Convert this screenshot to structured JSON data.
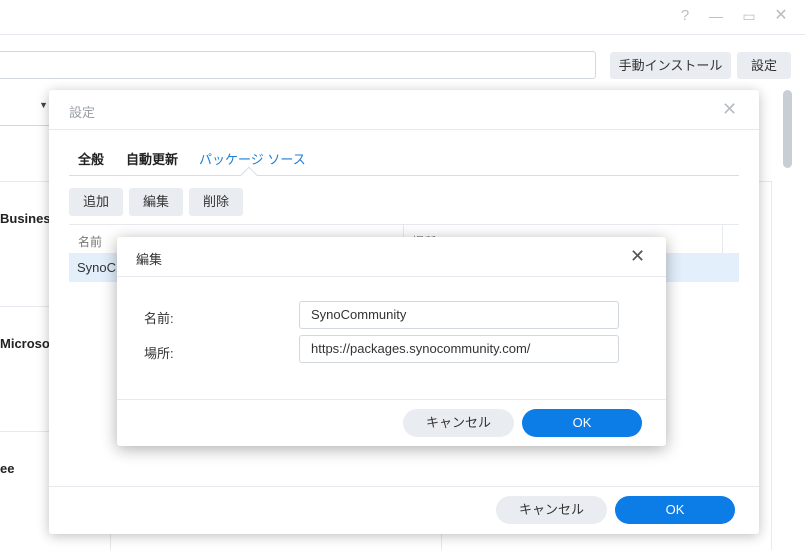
{
  "window": {
    "controls": {
      "help": "?",
      "minimize": "—",
      "maximize": "▭",
      "close": "✕"
    }
  },
  "toolbar": {
    "manual_install_label": "手動インストール",
    "settings_label": "設定"
  },
  "background_packages": [
    {
      "name": "Busines"
    },
    {
      "name": "Microso"
    },
    {
      "name": "ee"
    }
  ],
  "settings_dialog": {
    "title": "設定",
    "close_glyph": "✕",
    "tabs": [
      {
        "label": "全般"
      },
      {
        "label": "自動更新"
      },
      {
        "label": "パッケージ ソース"
      }
    ],
    "buttons": {
      "add": "追加",
      "edit": "編集",
      "delete": "削除"
    },
    "columns": {
      "name": "名前",
      "location": "場所"
    },
    "rows": [
      {
        "name": "SynoC"
      }
    ],
    "cancel_label": "キャンセル",
    "ok_label": "OK"
  },
  "edit_dialog": {
    "title": "編集",
    "close_glyph": "✕",
    "name_label": "名前:",
    "name_value": "SynoCommunity",
    "location_label": "場所:",
    "location_value": "https://packages.synocommunity.com/",
    "cancel_label": "キャンセル",
    "ok_label": "OK"
  },
  "colors": {
    "accent": "#0c7ce6",
    "tab_active": "#1d7ed8",
    "selected_row": "#e3effb",
    "button_gray": "#e9edf1"
  }
}
